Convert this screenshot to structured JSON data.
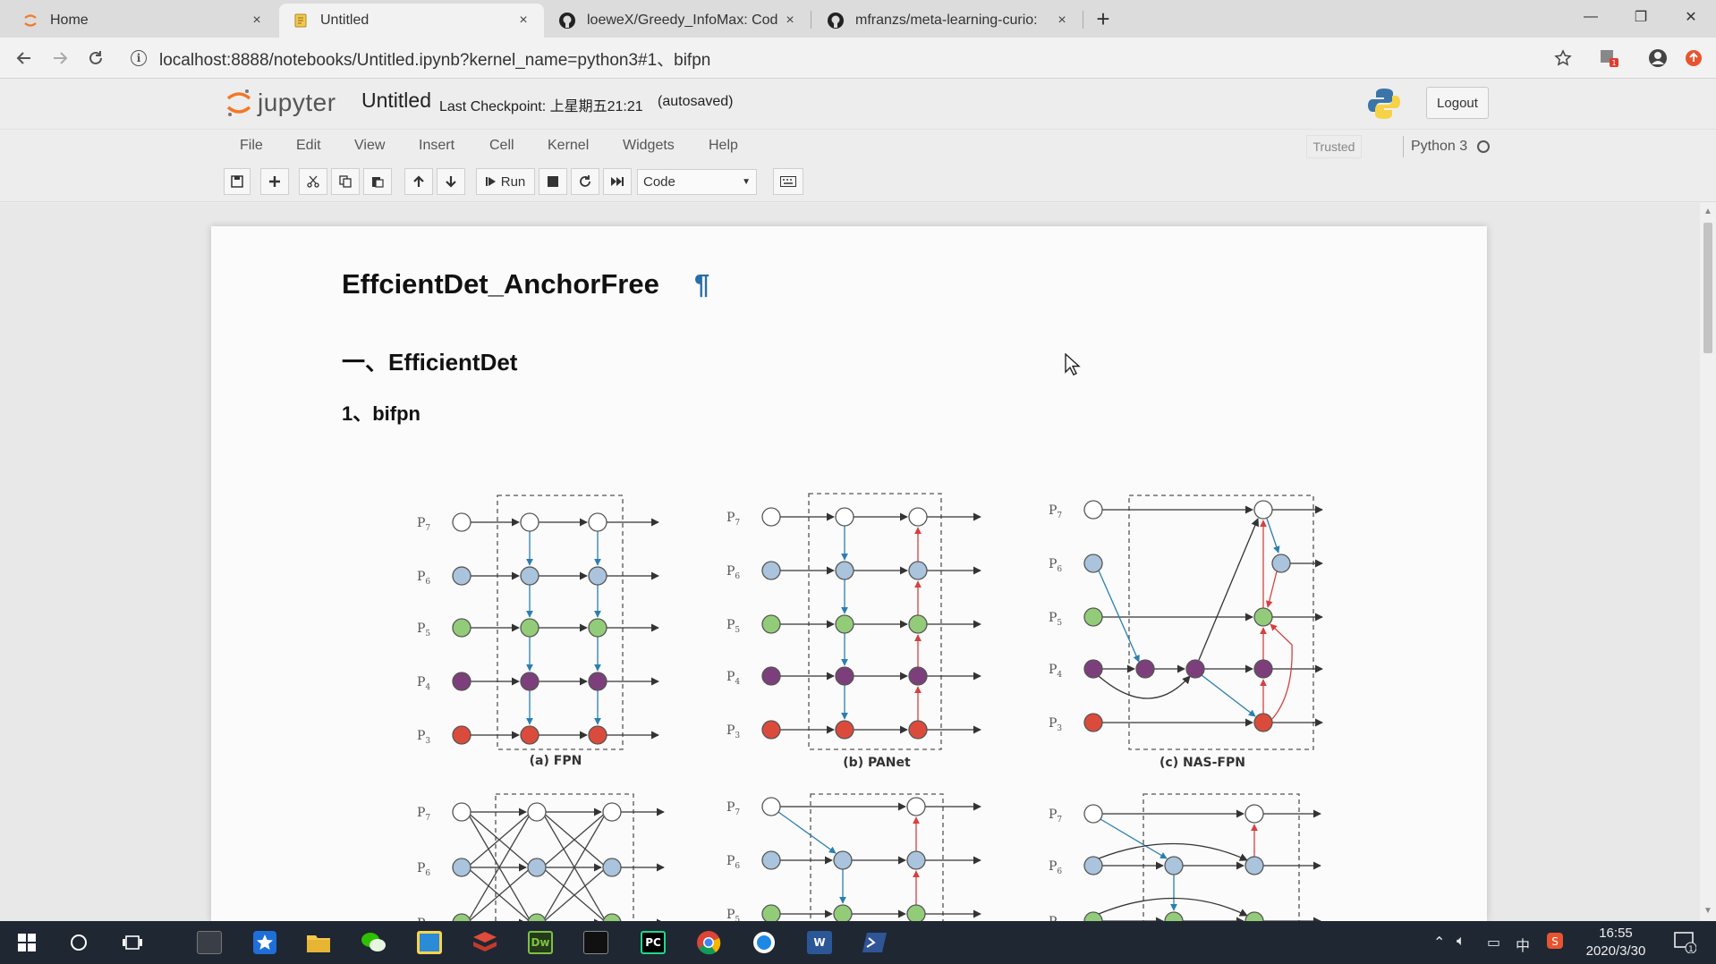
{
  "browser": {
    "tabs": [
      {
        "title": "Home",
        "icon": "jupyter-icon",
        "close": "×"
      },
      {
        "title": "Untitled",
        "icon": "notebook-icon",
        "close": "×"
      },
      {
        "title": "loeweX/Greedy_InfoMax: Cod",
        "icon": "github-icon",
        "close": "×"
      },
      {
        "title": "mfranzs/meta-learning-curio:",
        "icon": "github-icon",
        "close": "×"
      }
    ],
    "new_tab": "+",
    "url": "localhost:8888/notebooks/Untitled.ipynb?kernel_name=python3#1、bifpn",
    "window_controls": {
      "minimize": "—",
      "restore": "❐",
      "close": "✕"
    }
  },
  "jupyter": {
    "logo_text": "jupyter",
    "notebook_name": "Untitled",
    "checkpoint": "Last Checkpoint: 上星期五21:21",
    "autosave_status": "(autosaved)",
    "logout": "Logout",
    "menu": [
      "File",
      "Edit",
      "View",
      "Insert",
      "Cell",
      "Kernel",
      "Widgets",
      "Help"
    ],
    "trusted": "Trusted",
    "kernel": "Python 3",
    "run_label": "Run",
    "cell_type": "Code"
  },
  "notebook": {
    "title": "EffcientDet_AnchorFree",
    "anchor": "¶",
    "section": "一、EfficientDet",
    "subsection": "1、bifpn"
  },
  "figure": {
    "level_labels": [
      "P7",
      "P6",
      "P5",
      "P4",
      "P3"
    ],
    "captions": [
      "(a) FPN",
      "(b) PANet",
      "(c) NAS-FPN"
    ],
    "colors": {
      "P7": "#ffffff",
      "P6": "#a9c4dc",
      "P5": "#93cc79",
      "P4": "#7d3f7c",
      "P3": "#db4b3c",
      "top_down_arrow": "#2a7fb0",
      "bottom_up_arrow": "#d64040"
    }
  },
  "taskbar": {
    "clock_time": "16:55",
    "clock_date": "2020/3/30",
    "ime": "中",
    "notification_count": "1",
    "pinned": [
      "start-icon",
      "search-icon",
      "task-view-icon",
      "terminal-icon",
      "app-star-icon",
      "file-explorer-icon",
      "wechat-icon",
      "app-book-icon",
      "app-stack-icon",
      "dreamweaver-icon",
      "cmd-icon",
      "pycharm-icon",
      "chrome-icon",
      "qq-browser-icon",
      "word-icon",
      "powershell-icon"
    ],
    "pinned_labels": {
      "dreamweaver": "Dw",
      "pycharm": "PC",
      "word": "W"
    }
  }
}
